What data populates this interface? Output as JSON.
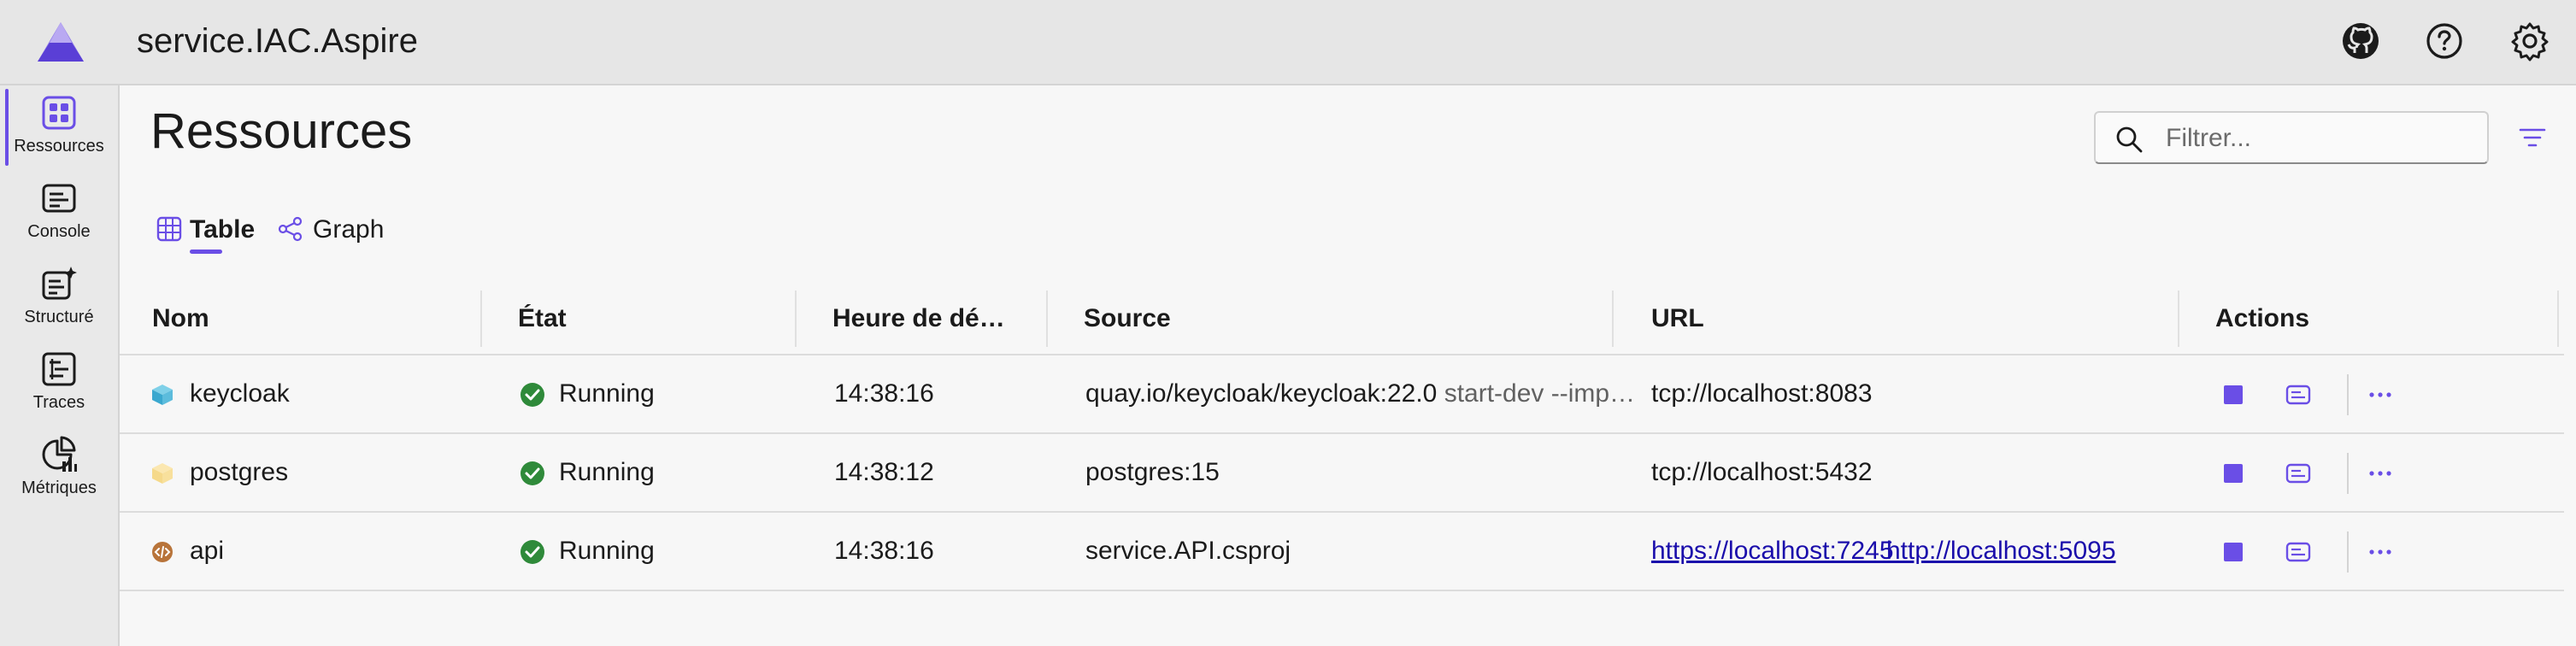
{
  "app": {
    "title": "service.IAC.Aspire"
  },
  "header": {
    "icons": [
      "github-icon",
      "help-icon",
      "settings-icon"
    ]
  },
  "sidebar": {
    "items": [
      {
        "label": "Ressources",
        "icon": "resources-icon",
        "active": true
      },
      {
        "label": "Console",
        "icon": "console-icon"
      },
      {
        "label": "Structuré",
        "icon": "structured-logs-icon"
      },
      {
        "label": "Traces",
        "icon": "traces-icon"
      },
      {
        "label": "Métriques",
        "icon": "metrics-icon"
      }
    ]
  },
  "page": {
    "title": "Ressources"
  },
  "search": {
    "placeholder": "Filtrer...",
    "value": ""
  },
  "tabs": [
    {
      "label": "Table",
      "icon": "table-icon",
      "active": true
    },
    {
      "label": "Graph",
      "icon": "graph-icon"
    }
  ],
  "table": {
    "columns": [
      "Nom",
      "État",
      "Heure de dé…",
      "Source",
      "URL",
      "Actions"
    ],
    "rows": [
      {
        "name": "keycloak",
        "icon": "container-icon",
        "state": "Running",
        "time": "14:38:16",
        "source": "quay.io/keycloak/keycloak:22.0",
        "source_args": "start-dev --imp…",
        "urls": [
          "tcp://localhost:8083"
        ],
        "url_links": false
      },
      {
        "name": "postgres",
        "icon": "container-icon",
        "state": "Running",
        "time": "14:38:12",
        "source": "postgres:15",
        "source_args": "",
        "urls": [
          "tcp://localhost:5432"
        ],
        "url_links": false
      },
      {
        "name": "api",
        "icon": "project-icon",
        "state": "Running",
        "time": "14:38:16",
        "source": "service.API.csproj",
        "source_args": "",
        "urls": [
          "https://localhost:7245",
          "http://localhost:5095"
        ],
        "url_links": true
      }
    ]
  },
  "colors": {
    "accent": "#6a4ee6",
    "running": "#2f8a3a",
    "link": "#1a0dab"
  }
}
